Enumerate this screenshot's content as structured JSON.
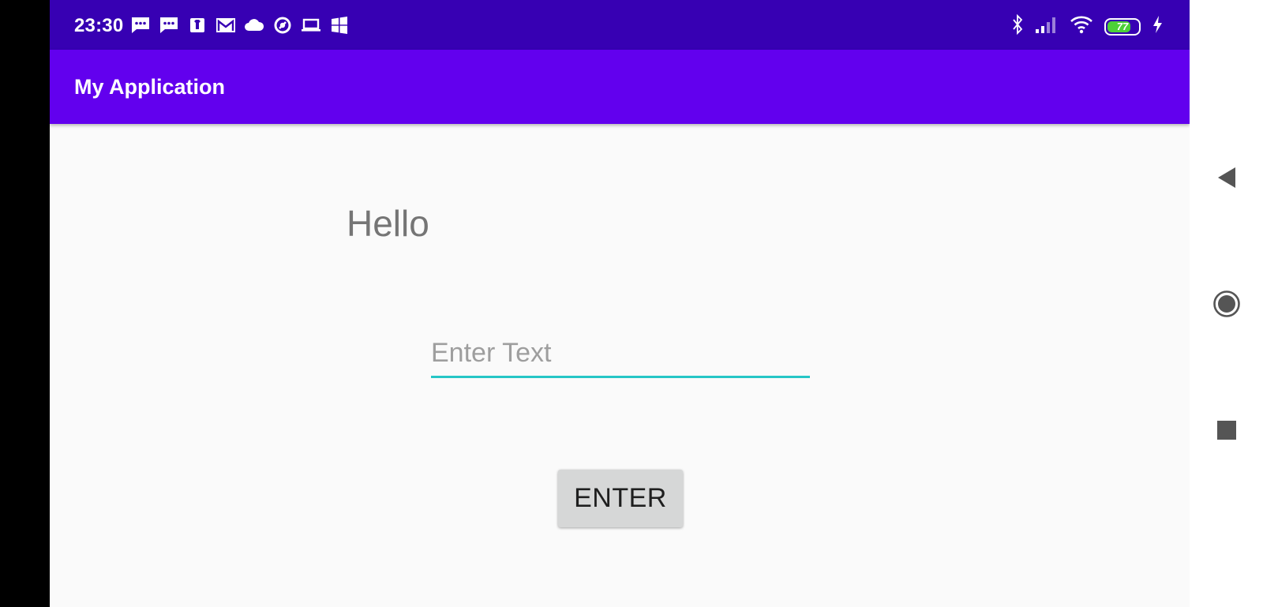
{
  "status_bar": {
    "time": "23:30",
    "notification_icons": [
      "sms-icon",
      "sms-icon",
      "shirt-app-icon",
      "gmail-icon",
      "cloud-icon",
      "data-saver-icon",
      "laptop-icon",
      "windows-icon"
    ],
    "system_icons": [
      "bluetooth-icon",
      "signal-icon",
      "wifi-icon",
      "battery-icon",
      "charging-icon"
    ],
    "battery_level": "77",
    "battery_fraction": 0.77,
    "background_color": "#3700b3"
  },
  "app_bar": {
    "title": "My Application",
    "background_color": "#6200ee"
  },
  "main": {
    "greeting": "Hello",
    "input": {
      "value": "",
      "placeholder": "Enter Text",
      "underline_color": "#26c6c6"
    },
    "enter_button_label": "ENTER"
  },
  "nav_bar": {
    "buttons": [
      "back",
      "home",
      "recents"
    ]
  }
}
